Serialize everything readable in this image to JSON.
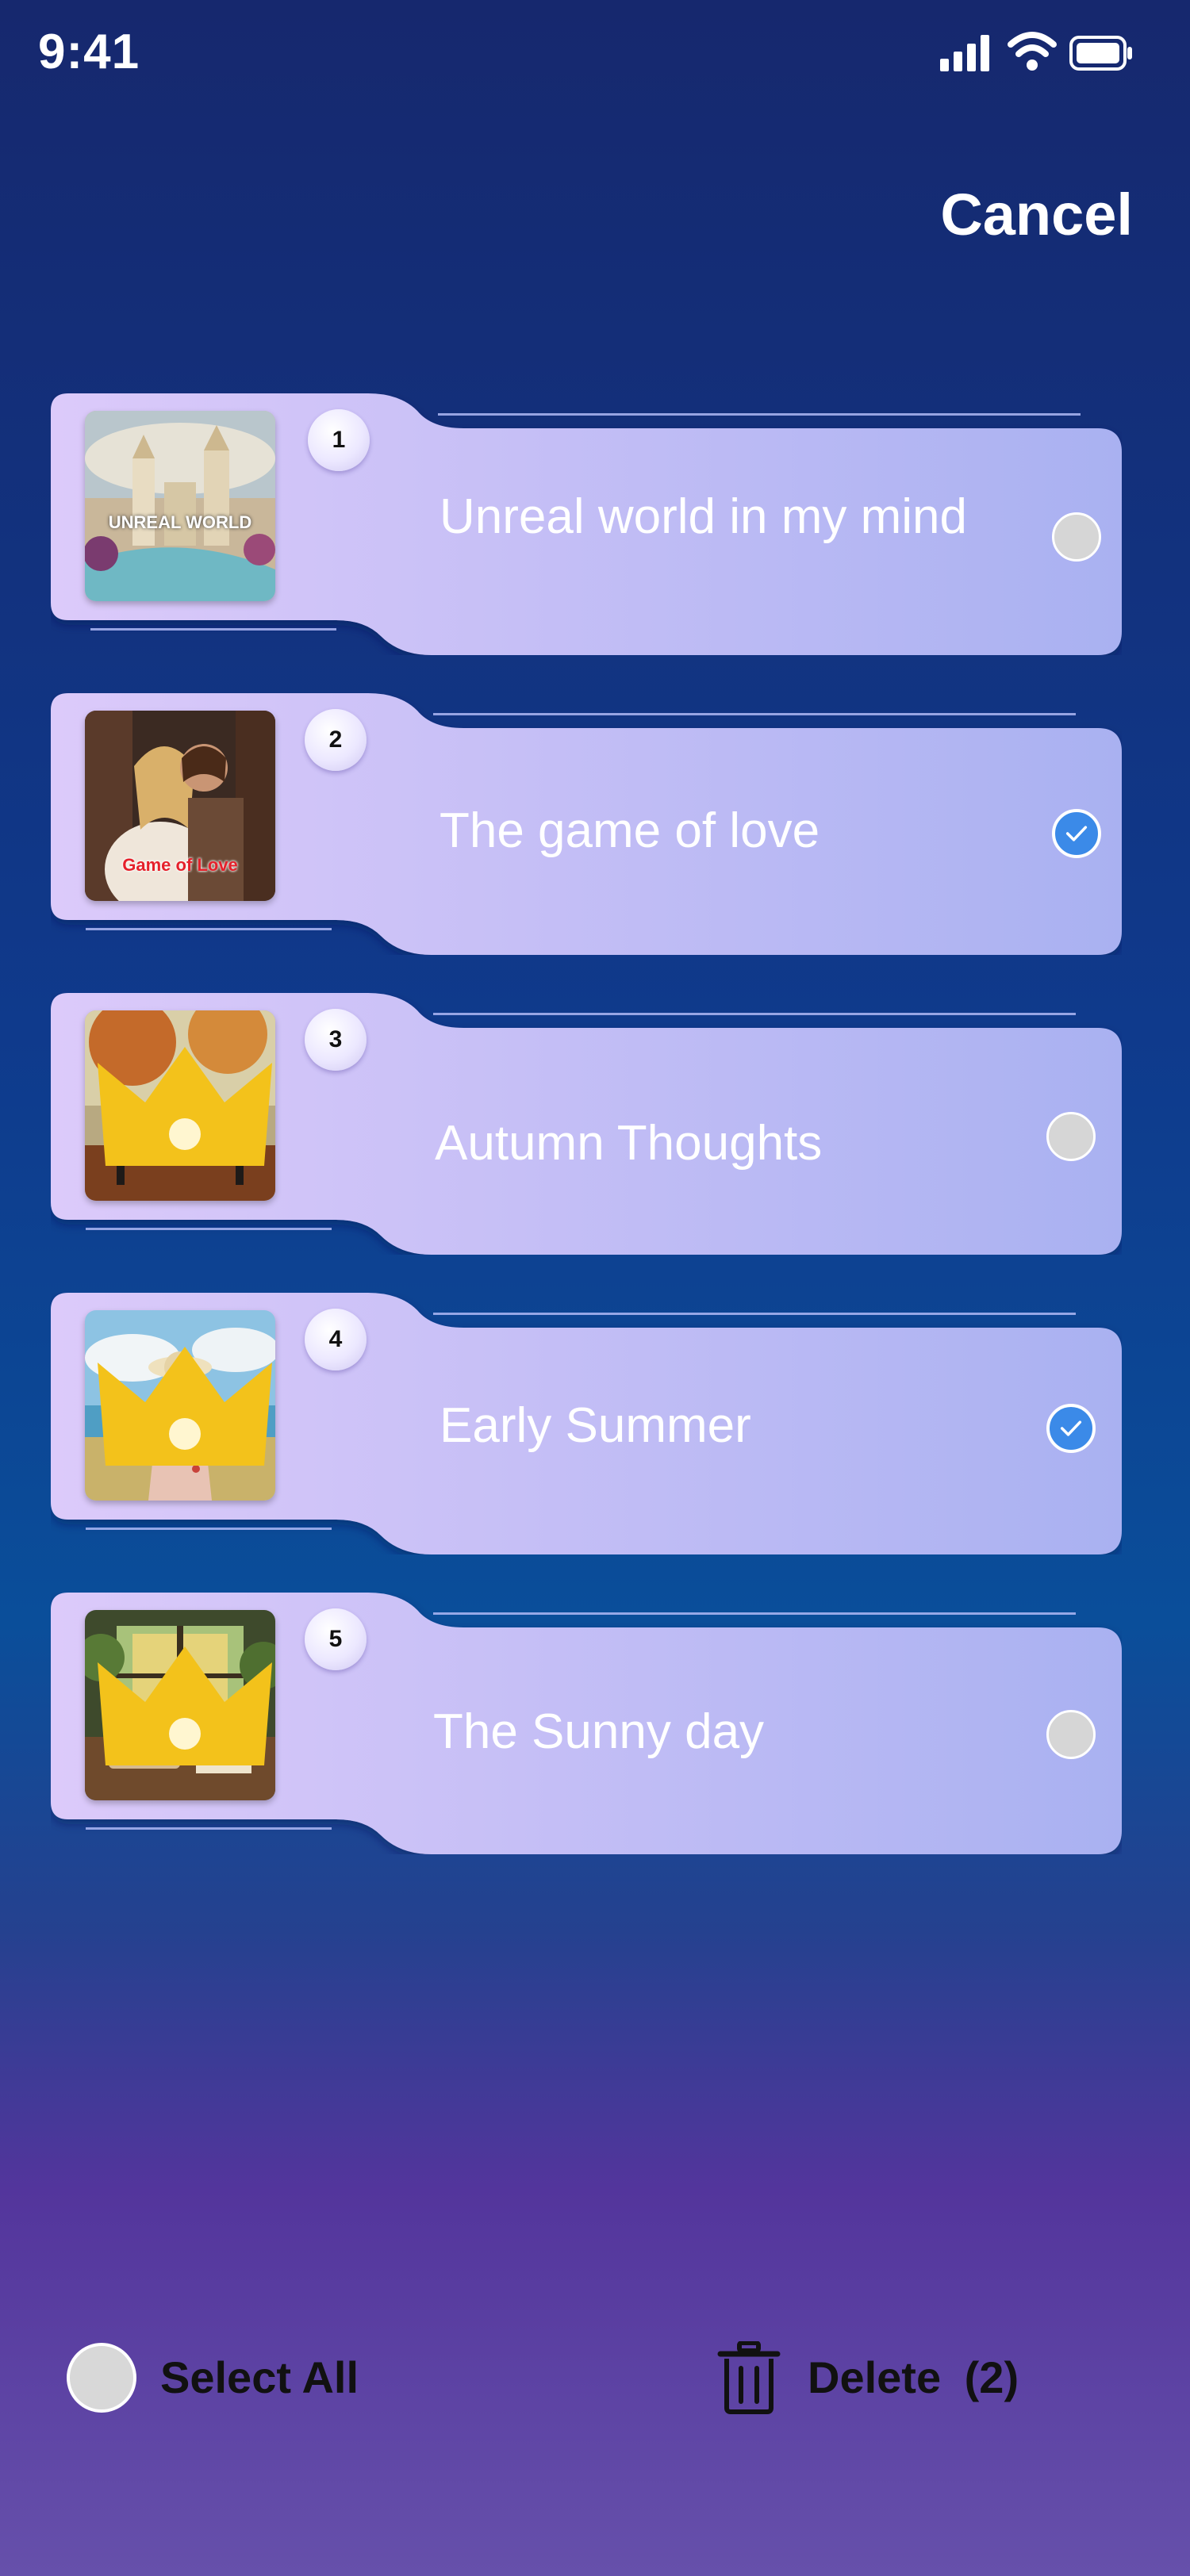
{
  "status_bar": {
    "time": "9:41",
    "icons": [
      "signal-icon",
      "wifi-icon",
      "battery-icon"
    ]
  },
  "header": {
    "cancel_label": "Cancel"
  },
  "colors": {
    "card_fill_start": "#d9c7fa",
    "card_fill_end": "#aab2f2",
    "check_blue": "#3b8ae8",
    "radio_gray": "#d6d6d6"
  },
  "items": [
    {
      "number": "1",
      "title": "Unreal world in my mind",
      "selected": false,
      "premium": false,
      "thumb_text": "UNREAL WORLD",
      "thumb_icon": "castle-scene-thumbnail"
    },
    {
      "number": "2",
      "title": "The game of love",
      "selected": true,
      "premium": false,
      "thumb_text": "Game of Love",
      "thumb_icon": "couple-scene-thumbnail"
    },
    {
      "number": "3",
      "title": "Autumn Thoughts",
      "selected": false,
      "premium": true,
      "thumb_text": "",
      "thumb_icon": "autumn-bench-thumbnail"
    },
    {
      "number": "4",
      "title": "Early Summer",
      "selected": true,
      "premium": true,
      "thumb_text": "",
      "thumb_icon": "beach-woman-thumbnail"
    },
    {
      "number": "5",
      "title": "The Sunny day",
      "selected": false,
      "premium": true,
      "thumb_text": "",
      "thumb_icon": "sunny-room-thumbnail"
    }
  ],
  "footer": {
    "select_all_label": "Select All",
    "delete_label": "Delete",
    "delete_count": "(2)"
  }
}
